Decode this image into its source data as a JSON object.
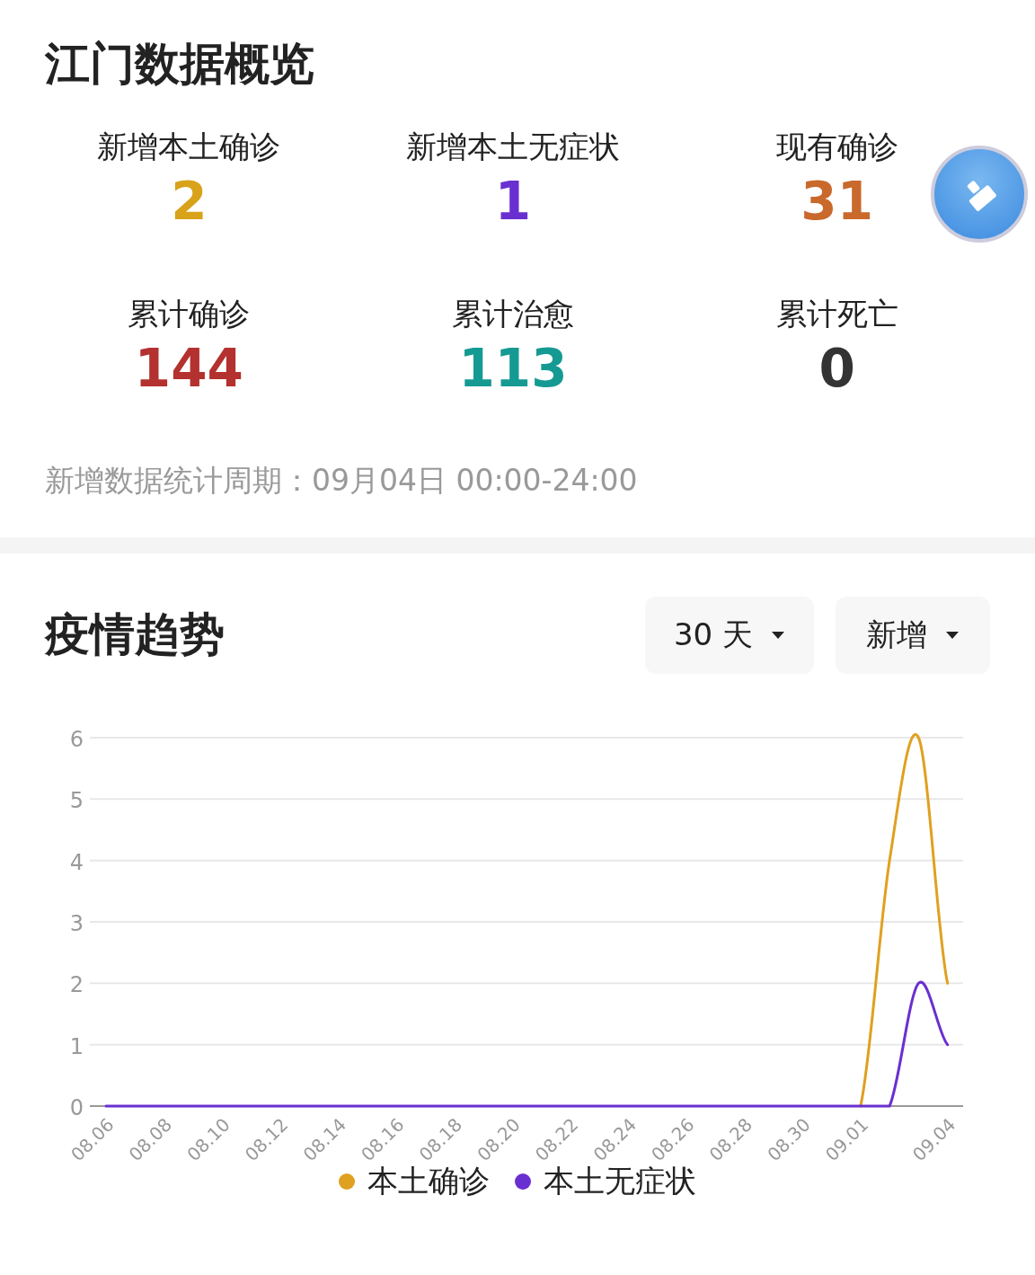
{
  "overview": {
    "title": "江门数据概览",
    "stats": [
      {
        "label": "新增本土确诊",
        "value": "2",
        "color": "#d9a21b"
      },
      {
        "label": "新增本土无症状",
        "value": "1",
        "color": "#6a2fd0"
      },
      {
        "label": "现有确诊",
        "value": "31",
        "color": "#c9692c"
      },
      {
        "label": "累计确诊",
        "value": "144",
        "color": "#b3312f"
      },
      {
        "label": "累计治愈",
        "value": "113",
        "color": "#159a93"
      },
      {
        "label": "累计死亡",
        "value": "0",
        "color": "#333333"
      }
    ],
    "period_note": "新增数据统计周期：09月04日 00:00-24:00"
  },
  "trend": {
    "title": "疫情趋势",
    "dropdowns": [
      "30 天",
      "新增"
    ],
    "chart_data": {
      "type": "line",
      "categories": [
        "08.06",
        null,
        "08.08",
        null,
        "08.10",
        null,
        "08.12",
        null,
        "08.14",
        null,
        "08.16",
        null,
        "08.18",
        null,
        "08.20",
        null,
        "08.22",
        null,
        "08.24",
        null,
        "08.26",
        null,
        "08.28",
        null,
        "08.30",
        null,
        "09.01",
        null,
        null,
        "09.04"
      ],
      "ylim": [
        0,
        6
      ],
      "yticks": [
        0,
        1,
        2,
        3,
        4,
        5,
        6
      ],
      "grid": true,
      "series": [
        {
          "name": "本土确诊",
          "color": "#e0a020",
          "values": [
            null,
            null,
            null,
            null,
            null,
            null,
            null,
            null,
            null,
            null,
            null,
            null,
            null,
            null,
            null,
            null,
            null,
            null,
            null,
            null,
            null,
            null,
            null,
            null,
            null,
            null,
            0,
            4,
            6,
            2
          ]
        },
        {
          "name": "本土无症状",
          "color": "#6a2fd0",
          "values": [
            0,
            0,
            0,
            0,
            0,
            0,
            0,
            0,
            0,
            0,
            0,
            0,
            0,
            0,
            0,
            0,
            0,
            0,
            0,
            0,
            0,
            0,
            0,
            0,
            0,
            0,
            0,
            0,
            2,
            1
          ]
        }
      ]
    }
  }
}
